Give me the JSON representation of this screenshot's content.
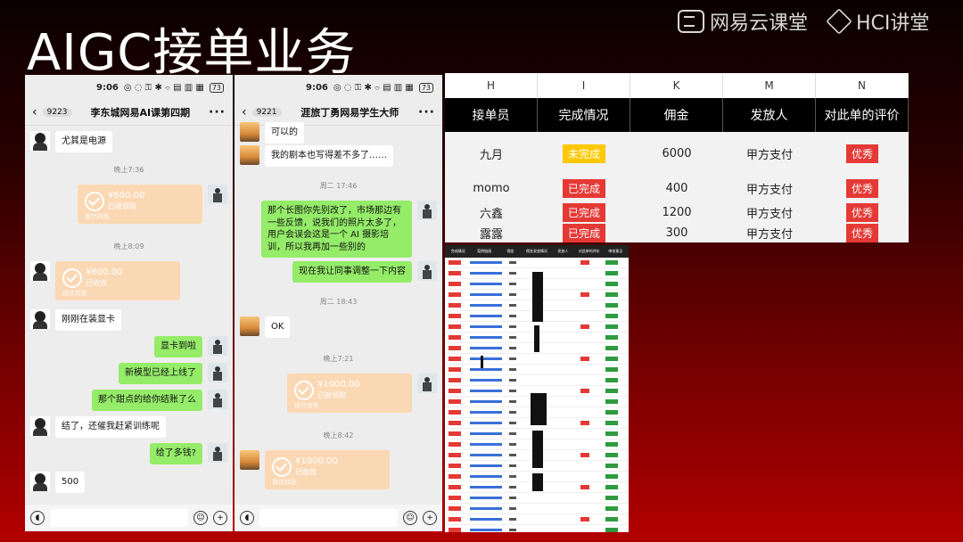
{
  "slide": {
    "title": "AIGC接单业务"
  },
  "brands": [
    {
      "label": "网易云课堂"
    },
    {
      "label": "HCI讲堂"
    }
  ],
  "phone1": {
    "time": "9:06",
    "status_icons": "◎ ◌ ⚿ ✱ ⌔ ▤ ▥ ▦",
    "battery": "73",
    "badge": "9223",
    "title": "李东城网易AI课第四期",
    "messages": [
      {
        "text": "尤其是电源"
      },
      {
        "time": "晚上7:36"
      },
      {
        "pay_amount": "¥600.00",
        "pay_status": "已被领取",
        "pay_footer": "微信转账"
      },
      {
        "time": "晚上8:09"
      },
      {
        "pay_amount": "¥600.00",
        "pay_status": "已收款",
        "pay_footer": "微信转账"
      },
      {
        "text": "刚刚在装显卡"
      },
      {
        "text": "显卡到啦"
      },
      {
        "text": "新模型已经上线了"
      },
      {
        "text": "那个甜点的给你结账了么"
      },
      {
        "text": "结了，还催我赶紧训练呢"
      },
      {
        "text": "给了多钱?"
      },
      {
        "text": "500"
      }
    ]
  },
  "phone2": {
    "time": "9:06",
    "status_icons": "◎ ◌ ⚿ ✱ ⌔ ▤ ▥ ▦",
    "battery": "73",
    "badge": "9221",
    "title": "涯旅丁勇网易学生大师",
    "messages": [
      {
        "text": "可以的"
      },
      {
        "text": "我的剧本也写得差不多了……"
      },
      {
        "time": "周二 17:46"
      },
      {
        "text": "那个长图你先别改了，市场那边有一些反馈，说我们的照片太多了，用户会误会这是一个 AI 摄影培训，所以我再加一些别的"
      },
      {
        "text": "现在我让同事调整一下内容"
      },
      {
        "time": "周二 18:43"
      },
      {
        "text": "OK"
      },
      {
        "time": "晚上7:21"
      },
      {
        "pay_amount": "¥1000.00",
        "pay_status": "已被领取",
        "pay_footer": "微信转账"
      },
      {
        "time": "晚上8:42"
      },
      {
        "pay_amount": "¥1000.00",
        "pay_status": "已收款",
        "pay_footer": "微信转账"
      }
    ]
  },
  "sheet": {
    "columns": [
      "H",
      "I",
      "K",
      "M",
      "N"
    ],
    "headers": [
      "接单员",
      "完成情况",
      "佣金",
      "发放人",
      "对此单的评价"
    ],
    "rows": [
      {
        "name": "九月",
        "status": "未完成",
        "status_color": "#ffc800",
        "commission": "6000",
        "payer": "甲方支付",
        "rating": "优秀"
      },
      {
        "name": "momo",
        "status": "已完成",
        "status_color": "#e53935",
        "commission": "400",
        "payer": "甲方支付",
        "rating": "优秀"
      },
      {
        "name": "六鑫",
        "status": "已完成",
        "status_color": "#e53935",
        "commission": "1200",
        "payer": "甲方支付",
        "rating": "优秀"
      },
      {
        "name": "露露",
        "status": "已完成",
        "status_color": "#e53935",
        "commission": "300",
        "payer": "甲方支付",
        "rating": "优秀"
      }
    ]
  },
  "thumbnail": {
    "headers": [
      "完成情况",
      "案例链接",
      "佣金",
      "佣金发放情况",
      "发放人",
      "对此单的评价",
      "审核意见"
    ]
  },
  "colors": {
    "accent_red": "#e53935",
    "accent_yellow": "#ffc800",
    "wechat_green": "#95ec69",
    "pay_orange": "#fbd8b4"
  }
}
